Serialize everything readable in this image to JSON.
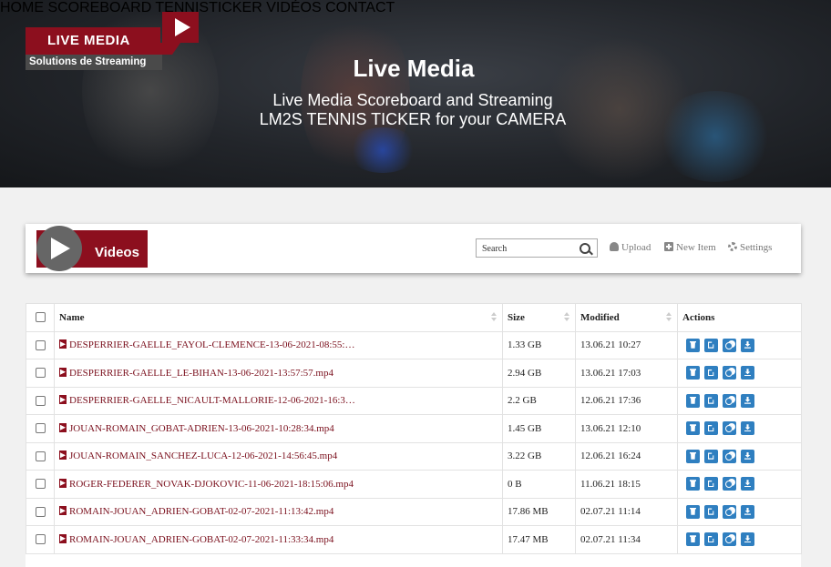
{
  "header": {
    "logo_title": "LIVE MEDIA",
    "logo_subtitle": "Solutions de Streaming",
    "nav": [
      "HOME",
      "SCOREBOARD",
      "TENNISTICKER",
      "VIDÉOS",
      "CONTACT"
    ],
    "title": "Live Media",
    "subtitle_1": "Live Media Scoreboard and Streaming",
    "subtitle_2": "LM2S TENNIS TICKER for your CAMERA"
  },
  "panel": {
    "label": "Videos",
    "search_placeholder": "Search",
    "upload_label": "Upload",
    "new_item_label": "New Item",
    "settings_label": "Settings"
  },
  "table": {
    "columns": [
      "Name",
      "Size",
      "Modified",
      "Actions"
    ],
    "rows": [
      {
        "name": "DESPERRIER-GAELLE_FAYOL-CLEMENCE-13-06-2021-08:55:…",
        "size": "1.33 GB",
        "modified": "13.06.21 10:27"
      },
      {
        "name": "DESPERRIER-GAELLE_LE-BIHAN-13-06-2021-13:57:57.mp4",
        "size": "2.94 GB",
        "modified": "13.06.21 17:03"
      },
      {
        "name": "DESPERRIER-GAELLE_NICAULT-MALLORIE-12-06-2021-16:3…",
        "size": "2.2 GB",
        "modified": "12.06.21 17:36"
      },
      {
        "name": "JOUAN-ROMAIN_GOBAT-ADRIEN-13-06-2021-10:28:34.mp4",
        "size": "1.45 GB",
        "modified": "13.06.21 12:10"
      },
      {
        "name": "JOUAN-ROMAIN_SANCHEZ-LUCA-12-06-2021-14:56:45.mp4",
        "size": "3.22 GB",
        "modified": "12.06.21 16:24"
      },
      {
        "name": "ROGER-FEDERER_NOVAK-DJOKOVIC-11-06-2021-18:15:06.mp4",
        "size": "0 B",
        "modified": "11.06.21 18:15"
      },
      {
        "name": "ROMAIN-JOUAN_ADRIEN-GOBAT-02-07-2021-11:13:42.mp4",
        "size": "17.86 MB",
        "modified": "02.07.21 11:14"
      },
      {
        "name": "ROMAIN-JOUAN_ADRIEN-GOBAT-02-07-2021-11:33:34.mp4",
        "size": "17.47 MB",
        "modified": "02.07.21 11:34"
      }
    ]
  },
  "colors": {
    "brand": "#8c0f1e",
    "action_button": "#2f7fc0"
  }
}
